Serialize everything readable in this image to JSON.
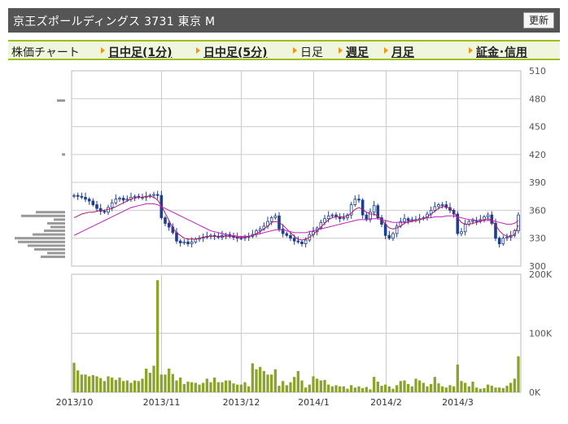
{
  "header": {
    "title": "京王ズポールディングス 3731 東京 M",
    "refresh_label": "更新"
  },
  "nav": {
    "label": "株価チャート",
    "items": [
      {
        "label": "日中足(1分)",
        "current": false
      },
      {
        "label": "日中足(5分)",
        "current": false
      },
      {
        "label": "日足",
        "current": true
      },
      {
        "label": "週足",
        "current": false
      },
      {
        "label": "月足",
        "current": false
      },
      {
        "label": "証金･信用",
        "current": false
      }
    ]
  },
  "colors": {
    "candle_up": "#1c3f94",
    "ma_short": "#b5176d",
    "ma_long": "#c020c0",
    "volume": "#8aa42a",
    "grid": "#cccccc",
    "profile": "#999999",
    "accent": "#9cbf1c"
  },
  "chart_data": [
    {
      "type": "candlestick",
      "ylim": [
        300,
        510
      ],
      "y_ticks": [
        300,
        330,
        360,
        390,
        420,
        450,
        480,
        510
      ],
      "x_tick_labels": [
        "2013/10",
        "2013/11",
        "2013/12",
        "2014/1",
        "2014/2",
        "2014/3"
      ],
      "x_tick_index": [
        0,
        23,
        44,
        63,
        82,
        101
      ],
      "close": [
        376,
        375,
        374,
        372,
        370,
        366,
        362,
        359,
        358,
        363,
        368,
        372,
        373,
        371,
        372,
        374,
        375,
        374,
        374,
        375,
        376,
        377,
        376,
        352,
        346,
        342,
        336,
        327,
        325,
        326,
        324,
        326,
        329,
        330,
        331,
        332,
        333,
        332,
        331,
        333,
        334,
        332,
        331,
        330,
        330,
        331,
        332,
        334,
        338,
        340,
        343,
        348,
        352,
        354,
        340,
        335,
        333,
        330,
        327,
        326,
        324,
        328,
        334,
        337,
        341,
        347,
        351,
        354,
        355,
        353,
        351,
        352,
        355,
        366,
        372,
        371,
        355,
        350,
        358,
        365,
        352,
        345,
        333,
        330,
        335,
        343,
        348,
        351,
        349,
        350,
        350,
        351,
        352,
        356,
        360,
        364,
        366,
        366,
        363,
        360,
        356,
        335,
        337,
        345,
        348,
        349,
        348,
        350,
        353,
        355,
        346,
        330,
        324,
        330,
        331,
        333,
        338,
        355
      ],
      "ma_short": [
        352,
        354,
        356,
        357,
        358,
        358,
        359,
        360,
        360,
        361,
        362,
        364,
        366,
        368,
        370,
        372,
        373,
        374,
        374,
        375,
        375,
        374,
        371,
        365,
        357,
        349,
        341,
        336,
        333,
        330,
        329,
        329,
        329,
        330,
        331,
        332,
        332,
        332,
        332,
        332,
        332,
        332,
        332,
        331,
        331,
        331,
        332,
        333,
        335,
        337,
        340,
        343,
        347,
        348,
        347,
        344,
        340,
        336,
        332,
        329,
        328,
        329,
        331,
        334,
        338,
        342,
        346,
        350,
        352,
        353,
        353,
        353,
        354,
        357,
        361,
        363,
        361,
        358,
        356,
        356,
        354,
        350,
        345,
        341,
        340,
        341,
        343,
        346,
        348,
        349,
        349,
        350,
        351,
        353,
        356,
        359,
        362,
        364,
        364,
        362,
        358,
        352,
        347,
        345,
        345,
        346,
        347,
        348,
        350,
        351,
        349,
        344,
        338,
        334,
        332,
        332,
        334,
        344
      ],
      "ma_long": [
        333,
        335,
        337,
        339,
        341,
        343,
        345,
        347,
        349,
        351,
        353,
        355,
        357,
        359,
        361,
        363,
        364,
        365,
        366,
        367,
        367,
        367,
        366,
        364,
        362,
        360,
        358,
        356,
        354,
        352,
        350,
        348,
        346,
        344,
        342,
        340,
        338,
        337,
        336,
        335,
        334,
        333,
        333,
        332,
        332,
        332,
        332,
        333,
        334,
        335,
        336,
        337,
        338,
        339,
        339,
        339,
        338,
        337,
        336,
        336,
        336,
        336,
        337,
        338,
        339,
        340,
        341,
        342,
        343,
        344,
        345,
        346,
        347,
        348,
        349,
        350,
        350,
        350,
        351,
        351,
        351,
        350,
        349,
        348,
        347,
        347,
        347,
        347,
        347,
        348,
        349,
        350,
        351,
        352,
        352,
        353,
        353,
        353,
        354,
        354,
        354,
        353,
        352,
        351,
        350,
        350,
        349,
        349,
        349,
        349,
        349,
        348,
        347,
        346,
        345,
        345,
        346,
        349
      ],
      "volume": [
        50,
        37,
        30,
        30,
        27,
        29,
        27,
        24,
        19,
        27,
        25,
        21,
        25,
        19,
        20,
        16,
        20,
        19,
        23,
        40,
        33,
        45,
        40,
        30,
        30,
        40,
        31,
        20,
        25,
        14,
        18,
        17,
        16,
        13,
        16,
        23,
        17,
        25,
        17,
        17,
        20,
        20,
        15,
        13,
        13,
        17,
        10,
        49,
        39,
        43,
        36,
        30,
        30,
        39,
        11,
        19,
        12,
        17,
        26,
        36,
        20,
        8,
        13,
        27,
        23,
        20,
        21,
        13,
        10,
        12,
        10,
        10,
        6,
        12,
        8,
        10,
        7,
        9,
        5,
        26,
        18,
        11,
        13,
        10,
        6,
        12,
        19,
        20,
        14,
        10,
        23,
        20,
        16,
        10,
        14,
        26,
        15,
        10,
        8,
        12,
        10,
        47,
        19,
        16,
        10,
        18,
        8,
        6,
        7,
        13,
        11,
        8,
        8,
        7,
        11,
        16,
        23,
        61
      ],
      "volume_ylim": [
        0,
        200000
      ],
      "volume_ticks": [
        0,
        100000,
        200000
      ],
      "volume_tick_labels": [
        "0K",
        "100K",
        "200K"
      ],
      "volume_spike": {
        "index": 22,
        "value": 190000
      }
    }
  ]
}
